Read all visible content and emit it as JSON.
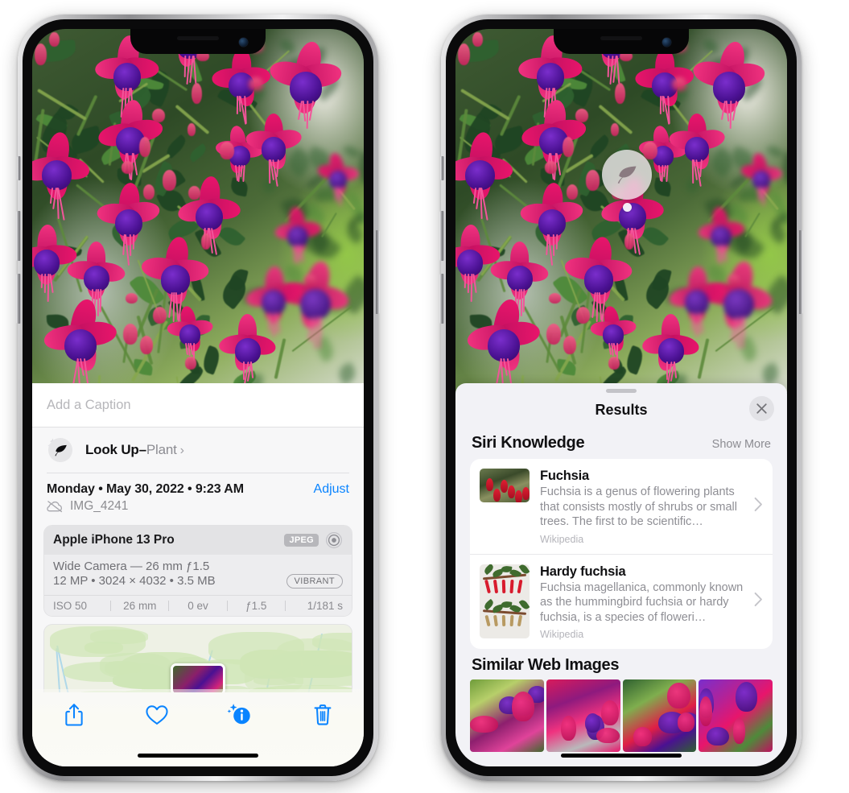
{
  "left_phone": {
    "caption_field": {
      "placeholder": "Add a Caption",
      "value": ""
    },
    "lookup_row": {
      "label": "Look Up",
      "dash": "–",
      "subject": "Plant",
      "icon": "leaf-sparkle-icon",
      "chevron": "›"
    },
    "date_row": {
      "date_text": "Monday • May 30, 2022 • 9:23 AM",
      "adjust_label": "Adjust"
    },
    "file_row": {
      "icon": "cloud-slash-icon",
      "filename": "IMG_4241"
    },
    "exif": {
      "device": "Apple iPhone 13 Pro",
      "format_badge": "JPEG",
      "lens_icon": "aperture-icon",
      "lens_line": "Wide Camera — 26 mm ƒ1.5",
      "size_line": "12 MP • 3024 × 4032 • 3.5 MB",
      "style_badge": "VIBRANT",
      "stats": [
        "ISO 50",
        "26 mm",
        "0 ev",
        "ƒ1.5",
        "1/181 s"
      ]
    },
    "toolbar": [
      {
        "name": "share-button",
        "icon": "share-icon"
      },
      {
        "name": "favorite-button",
        "icon": "heart-icon"
      },
      {
        "name": "info-button",
        "icon": "info-sparkle-icon"
      },
      {
        "name": "delete-button",
        "icon": "trash-icon"
      }
    ],
    "accent_color": "#0a84ff"
  },
  "right_phone": {
    "visual_lookup_badge": {
      "icon": "leaf-icon"
    },
    "sheet_header": {
      "title": "Results",
      "close_icon": "close-icon"
    },
    "siri_knowledge": {
      "heading": "Siri Knowledge",
      "action_label": "Show More",
      "items": [
        {
          "title": "Fuchsia",
          "description": "Fuchsia is a genus of flowering plants that consists mostly of shrubs or small trees. The first to be scientific…",
          "source": "Wikipedia",
          "chevron": "›"
        },
        {
          "title": "Hardy fuchsia",
          "description": "Fuchsia magellanica, commonly known as the hummingbird fuchsia or hardy fuchsia, is a species of floweri…",
          "source": "Wikipedia",
          "chevron": "›"
        }
      ]
    },
    "similar_web_images": {
      "heading": "Similar Web Images",
      "count": 4
    }
  }
}
